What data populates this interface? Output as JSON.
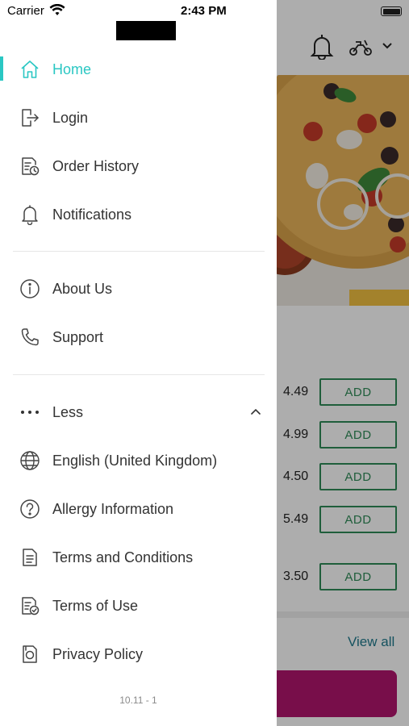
{
  "status_bar": {
    "carrier": "Carrier",
    "time": "2:43 PM"
  },
  "drawer": {
    "primary_items": [
      {
        "label": "Home",
        "icon": "home-icon",
        "active": true
      },
      {
        "label": "Login",
        "icon": "login-icon"
      },
      {
        "label": "Order History",
        "icon": "order-history-icon"
      },
      {
        "label": "Notifications",
        "icon": "bell-icon"
      }
    ],
    "secondary_items": [
      {
        "label": "About Us",
        "icon": "info-icon"
      },
      {
        "label": "Support",
        "icon": "phone-icon"
      }
    ],
    "less_toggle": {
      "label": "Less",
      "icon": "more-dots-icon"
    },
    "extra_items": [
      {
        "label": "English (United Kingdom)",
        "icon": "globe-icon"
      },
      {
        "label": "Allergy Information",
        "icon": "question-icon"
      },
      {
        "label": "Terms and Conditions",
        "icon": "document-icon"
      },
      {
        "label": "Terms of Use",
        "icon": "document-check-icon"
      },
      {
        "label": "Privacy Policy",
        "icon": "privacy-icon"
      }
    ],
    "version": "10.11 - 1"
  },
  "background": {
    "prices": [
      {
        "price": "4.49",
        "button": "ADD"
      },
      {
        "price": "4.99",
        "button": "ADD"
      },
      {
        "price": "4.50",
        "button": "ADD"
      },
      {
        "price": "5.49",
        "button": "ADD"
      },
      {
        "price": "3.50",
        "button": "ADD"
      }
    ],
    "view_all": "View all"
  },
  "colors": {
    "accent": "#2ac7c3",
    "add_button": "#2e8b57",
    "cta": "#b1166e",
    "link": "#1f7a8c"
  }
}
